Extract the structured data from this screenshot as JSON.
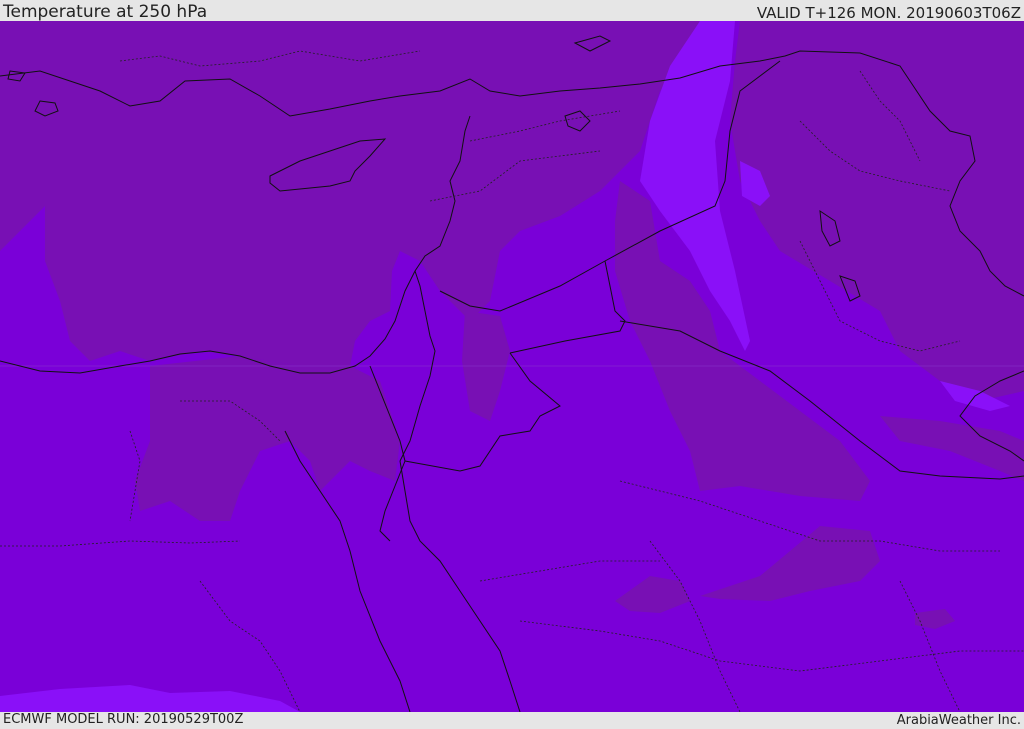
{
  "header": {
    "title": "Temperature at 250 hPa",
    "valid": "VALID T+126 MON. 20190603T06Z"
  },
  "footer": {
    "model_run": "ECMWF MODEL RUN: 20190529T00Z",
    "credit": "ArabiaWeather Inc."
  },
  "map": {
    "colors": {
      "warm_band": "#7810b4",
      "base": "#7a00d8",
      "cool": "#8a10f8",
      "borders": "#111111"
    }
  }
}
